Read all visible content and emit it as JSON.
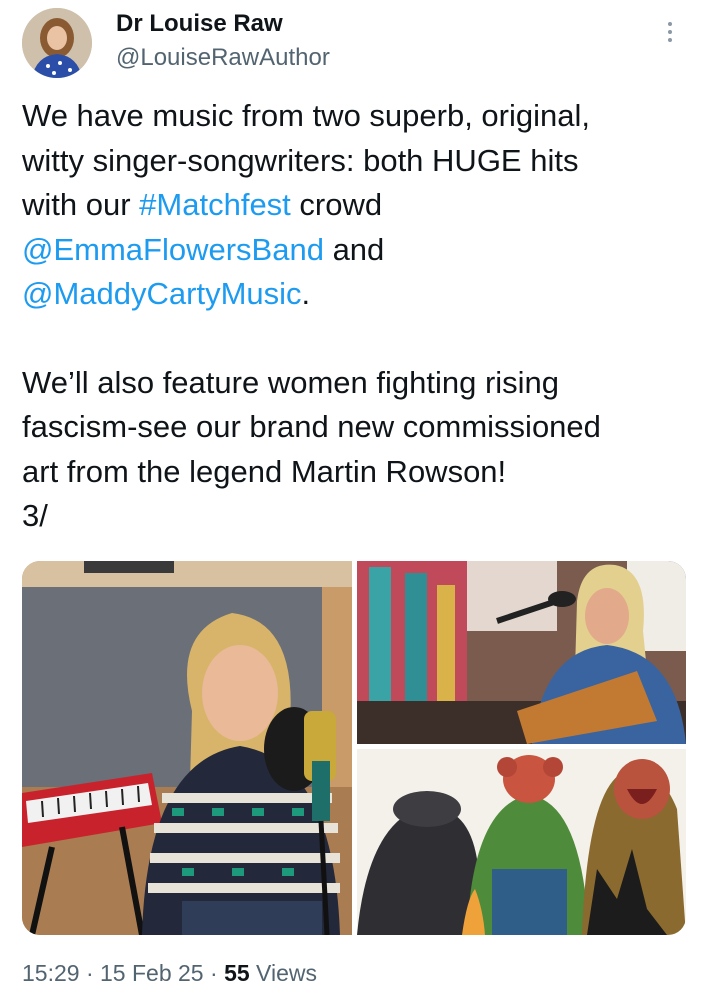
{
  "author": {
    "name": "Dr Louise Raw",
    "handle": "@LouiseRawAuthor"
  },
  "tweet": {
    "line1": "We have music from two superb, original,",
    "line2": "witty singer-songwriters: both HUGE hits",
    "line3_pre": "with our ",
    "hashtag": "#Matchfest",
    "line3_post": " crowd",
    "mention1": "@EmmaFlowersBand",
    "line4_post": " and",
    "mention2": "@MaddyCartyMusic",
    "line5_post": ".",
    "para2_line1": "We’ll also feature women  fighting rising",
    "para2_line2": "fascism-see our brand new commissioned",
    "para2_line3": "art from the legend Martin Rowson!",
    "thread_marker": "3/"
  },
  "meta": {
    "time": "15:29",
    "sep1": " · ",
    "date": "15 Feb 25",
    "sep2": " · ",
    "views_count": "55",
    "views_label": " Views"
  },
  "colors": {
    "link": "#1d9bf0",
    "secondary_text": "#536471",
    "primary_text": "#0f1419"
  },
  "icons": [
    "more-options-icon"
  ]
}
